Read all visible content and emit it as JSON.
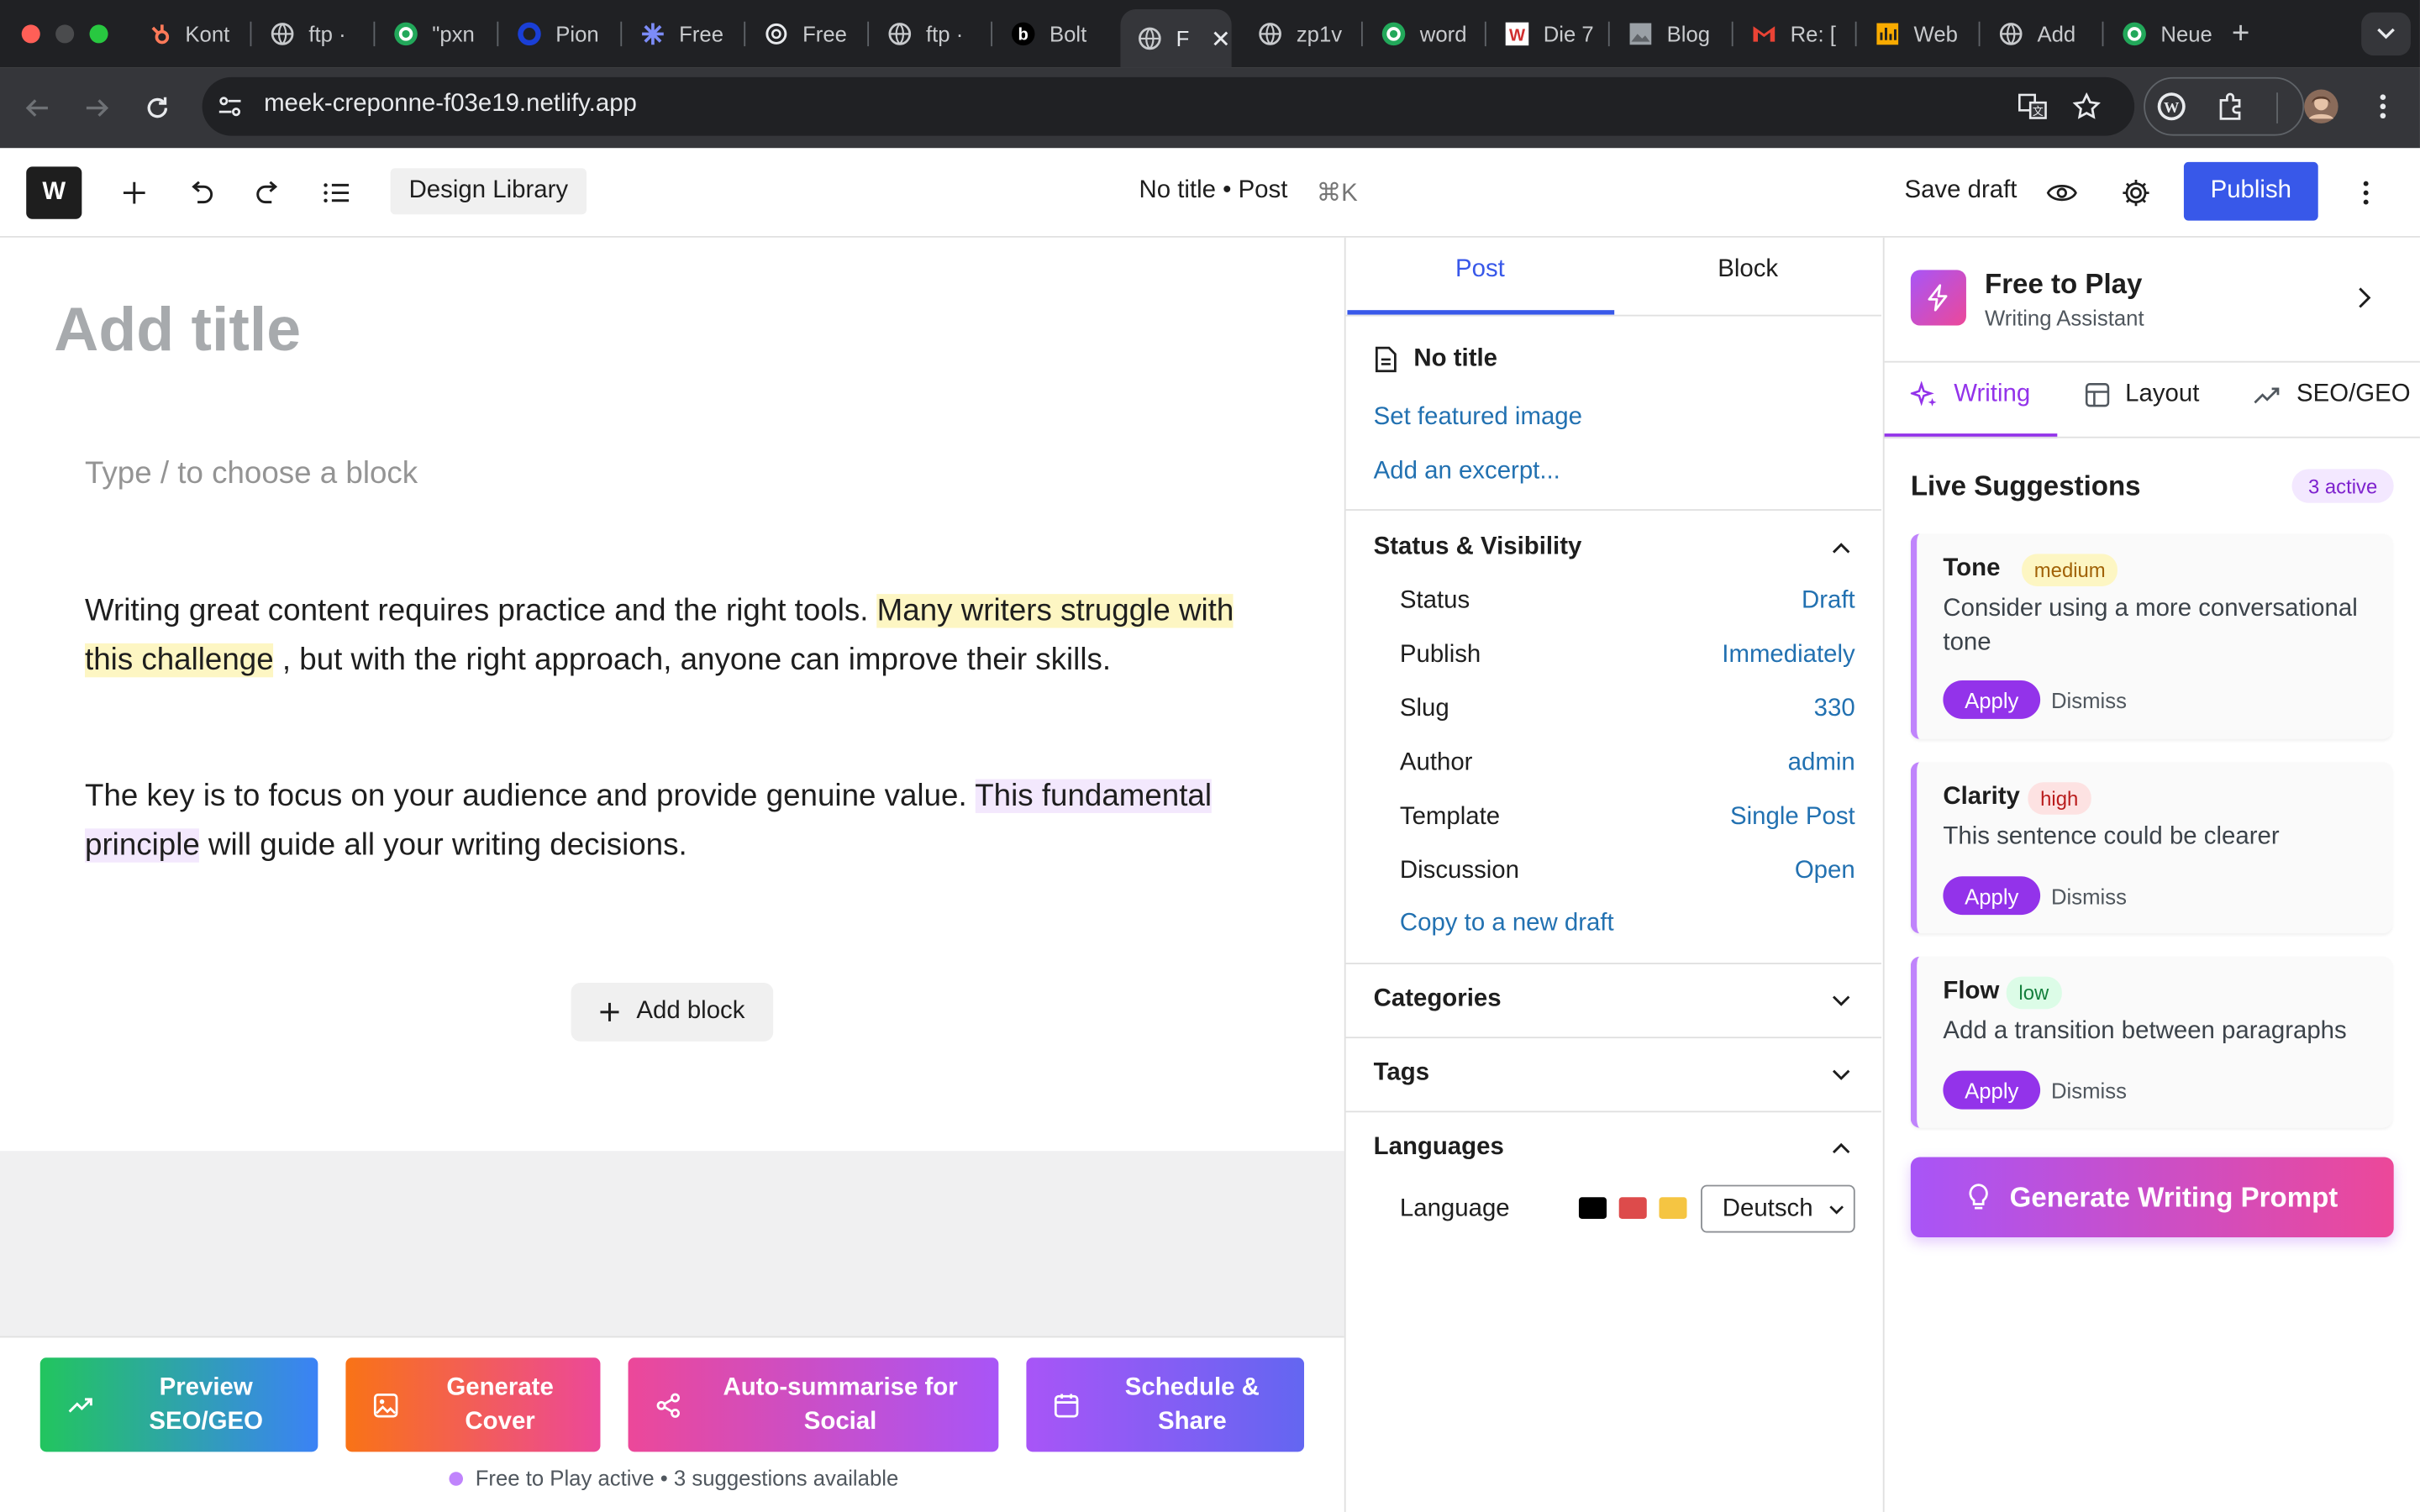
{
  "browser": {
    "tabs": [
      {
        "label": "Kont",
        "icon": "hubspot-icon"
      },
      {
        "label": "ftp ·",
        "icon": "globe-icon"
      },
      {
        "label": "\"pxn",
        "icon": "green-badge-icon"
      },
      {
        "label": "Pion",
        "icon": "blue-circle-icon"
      },
      {
        "label": "Free",
        "icon": "claude-star-icon"
      },
      {
        "label": "Free",
        "icon": "openai-icon"
      },
      {
        "label": "ftp ·",
        "icon": "globe-icon"
      },
      {
        "label": "Bolt",
        "icon": "bolt-icon"
      },
      {
        "label": "F",
        "icon": "globe-icon"
      },
      {
        "label": "zp1v",
        "icon": "globe-icon"
      },
      {
        "label": "word",
        "icon": "green-badge-icon"
      },
      {
        "label": "Die 7",
        "icon": "w-icon"
      },
      {
        "label": "Blog",
        "icon": "image-icon"
      },
      {
        "label": "Re: [",
        "icon": "gmail-icon"
      },
      {
        "label": "Web",
        "icon": "chart-icon"
      },
      {
        "label": "Add",
        "icon": "globe-icon"
      },
      {
        "label": "Neue",
        "icon": "green-badge-icon"
      }
    ],
    "active_tab_index": 8,
    "url": "meek-creponne-f03e19.netlify.app"
  },
  "wp_toolbar": {
    "logo_text": "W",
    "design_library": "Design Library",
    "document_title": "No title • Post",
    "shortcut": "⌘K",
    "save_draft": "Save draft",
    "publish": "Publish"
  },
  "editor": {
    "title_placeholder": "Add title",
    "block_placeholder": "Type / to choose a block",
    "para1": {
      "before": "Writing great content requires practice and the right tools. ",
      "highlight": "Many writers struggle with this challenge",
      "after": " , but with the right approach, anyone can improve their skills."
    },
    "para2": {
      "before": "The key is to focus on your audience and provide genuine value. ",
      "highlight": "This fundamental principle",
      "after": " will guide all your writing decisions."
    },
    "add_block": "Add block"
  },
  "bottom_actions": {
    "preview": "Preview SEO/GEO",
    "cover": "Generate Cover",
    "summarise": "Auto-summarise for Social",
    "schedule": "Schedule & Share",
    "status": "Free to Play active • 3 suggestions available"
  },
  "settings": {
    "tabs": [
      "Post",
      "Block"
    ],
    "doc_title": "No title",
    "featured_image": "Set featured image",
    "excerpt": "Add an excerpt...",
    "status_heading": "Status & Visibility",
    "rows": [
      {
        "label": "Status",
        "value": "Draft"
      },
      {
        "label": "Publish",
        "value": "Immediately"
      },
      {
        "label": "Slug",
        "value": "330"
      },
      {
        "label": "Author",
        "value": "admin"
      },
      {
        "label": "Template",
        "value": "Single Post"
      },
      {
        "label": "Discussion",
        "value": "Open"
      }
    ],
    "copy_draft": "Copy to a new draft",
    "categories": "Categories",
    "tags": "Tags",
    "languages": "Languages",
    "language_label": "Language",
    "language_value": "Deutsch",
    "flag_colors": [
      "#000000",
      "#dd4b4b",
      "#f5c542"
    ]
  },
  "assistant": {
    "title": "Free to Play",
    "subtitle": "Writing Assistant",
    "tabs": [
      "Writing",
      "Layout",
      "SEO/GEO"
    ],
    "live_heading": "Live Suggestions",
    "active_badge": "3 active",
    "suggestions": [
      {
        "title": "Tone",
        "severity": "medium",
        "text": "Consider using a more conversational tone",
        "apply": "Apply",
        "dismiss": "Dismiss"
      },
      {
        "title": "Clarity",
        "severity": "high",
        "text": "This sentence could be clearer",
        "apply": "Apply",
        "dismiss": "Dismiss"
      },
      {
        "title": "Flow",
        "severity": "low",
        "text": "Add a transition between paragraphs",
        "apply": "Apply",
        "dismiss": "Dismiss"
      }
    ],
    "generate_prompt": "Generate Writing Prompt"
  },
  "colors": {
    "wp_blue": "#3858e9",
    "link_blue": "#2271b1",
    "assistant_purple": "#9333ea",
    "assistant_pink": "#ec4899"
  }
}
